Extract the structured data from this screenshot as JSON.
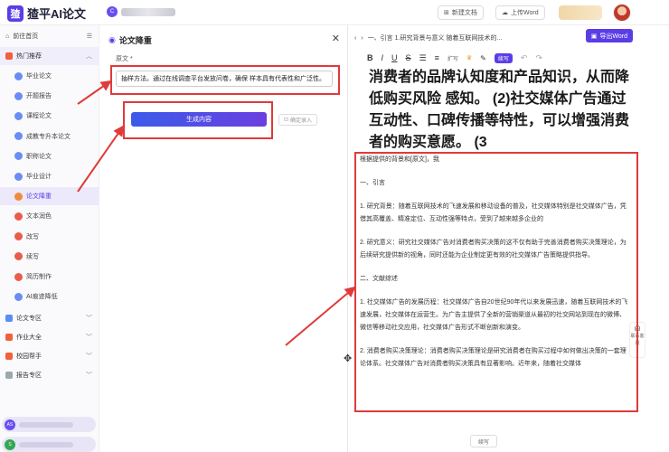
{
  "app": {
    "logo_mark": "猹",
    "logo_text": "猹平AI论文",
    "user_tag": "C"
  },
  "topbar": {
    "new_doc": "新建文档",
    "upload_word": "上传Word"
  },
  "sidebar": {
    "back": "前往首页",
    "hot": "热门推荐",
    "items": [
      {
        "label": "毕业论文",
        "icon": "blue"
      },
      {
        "label": "开题报告",
        "icon": "blue"
      },
      {
        "label": "课程论文",
        "icon": "blue"
      },
      {
        "label": "成教专升本论文",
        "icon": "blue"
      },
      {
        "label": "职称论文",
        "icon": "blue"
      },
      {
        "label": "毕业设计",
        "icon": "blue"
      },
      {
        "label": "论文降重",
        "icon": "orange",
        "active": true
      },
      {
        "label": "文本润色",
        "icon": "red"
      },
      {
        "label": "改写",
        "icon": "red"
      },
      {
        "label": "续写",
        "icon": "red"
      },
      {
        "label": "简历制作",
        "icon": "red"
      },
      {
        "label": "AI痕迹降低",
        "icon": "blue"
      }
    ],
    "sections": [
      "论文专区",
      "作业大全",
      "校园帮手",
      "报告专区"
    ],
    "pill1_tag": "AS",
    "pill2_tag": "S"
  },
  "mid": {
    "title": "论文降重",
    "label": "原文 *",
    "input_value": "抽样方法。通过在线调查平台发放问卷，确保 样本具有代表性和广泛性。",
    "generate": "生成内容",
    "confirm": "确定录入"
  },
  "editor": {
    "breadcrumb": "一、引言 1.研究背景与意义 随着互联网技术的...",
    "export": "导出Word",
    "tools": [
      "B",
      "I",
      "U",
      "S"
    ],
    "tool_expand": "扩写",
    "tool_continue": "续写",
    "big_text": "消费者的品牌认知度和产品知识，从而降低购买风险 感知。 (2)社交媒体广告通过互动性、口碑传播等特性，可以增强消费者的购买意愿。 (3",
    "body": [
      "根据提供的背景和[原文]，我",
      "一、引言",
      "1. 研究背景：随着互联网技术的飞速发展和移动设备的普及，社交媒体特别是社交媒体广告，凭借其高覆盖、精准定位、互动性强等特点，受到了越来越多企业的",
      "2. 研究意义：研究社交媒体广告对消费者购买决策的这不仅有助于完善消费者购买决策理论，为后续研究提供新的视角，同时还能为企业制定更有效的社交媒体广告策略提供指导。",
      "二、文献综述",
      "1. 社交媒体广告的发展历程：社交媒体广告自20世纪90年代以来发展迅速，随着互联网技术的飞速发展，社交媒体在运营生。为广告主提供了全新的营销渠道从最初的社交网站到现在的微博、微信等移动社交应用，社交媒体广告形式不断创新和演变。",
      "2. 消费者购买决策理论：消费者购买决策理论是研究消费者在购买过程中如何做出决策的一套理论体系。社交媒体广告对消费者购买决策具有显著影响。近年来，随着社交媒体"
    ],
    "float_text": "联系客服",
    "bottom_btn": "续写"
  }
}
